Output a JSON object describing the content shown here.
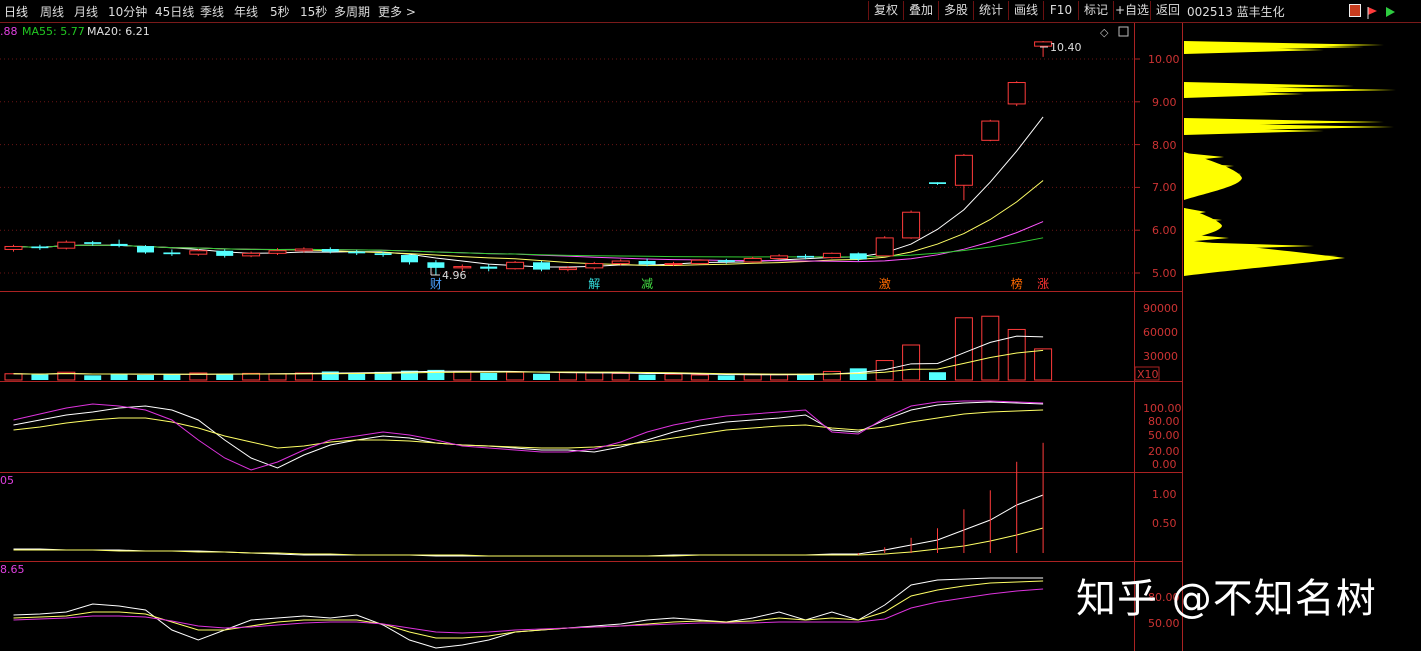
{
  "toolbar": {
    "periods": [
      "日线",
      "周线",
      "月线",
      "10分钟",
      "45日线",
      "季线",
      "年线",
      "5秒",
      "15秒",
      "多周期",
      "更多 >"
    ],
    "buttons": [
      "复权",
      "叠加",
      "多股",
      "统计",
      "画线",
      "F10",
      "标记",
      "+自选",
      "返回"
    ],
    "stock": "002513 蓝丰生化"
  },
  "main_panel": {
    "ma_labels": [
      {
        "text": ".88",
        "color": "#e040e0"
      },
      {
        "text": "MA55: 5.77",
        "color": "#22c822"
      },
      {
        "text": "MA20: 6.21",
        "color": "#e0e0e0"
      }
    ],
    "max_label": "10.40",
    "min_label": "4.96",
    "price_axis": [
      "10.00",
      "9.00",
      "8.00",
      "7.00",
      "6.00",
      "5.00"
    ],
    "event_markers": [
      {
        "text": "财",
        "color": "#4aa0ff",
        "bar": 16
      },
      {
        "text": "解",
        "color": "#33dddd",
        "bar": 22
      },
      {
        "text": "减",
        "color": "#44dd44",
        "bar": 24
      },
      {
        "text": "激",
        "color": "#ff6a00",
        "bar": 33
      },
      {
        "text": "榜",
        "color": "#ff6a00",
        "bar": 38
      },
      {
        "text": "涨",
        "color": "#ff3333",
        "bar": 39
      }
    ]
  },
  "volume_panel": {
    "axis": [
      "90000",
      "60000",
      "30000"
    ],
    "unit": "X10"
  },
  "panel3": {
    "axis": [
      "100.00",
      "80.00",
      "50.00",
      "20.00",
      "0.00"
    ]
  },
  "panel4": {
    "label": "05",
    "axis": [
      "1.00",
      "0.50"
    ]
  },
  "panel5": {
    "label": "8.65",
    "axis": [
      "80.00",
      "50.00"
    ]
  },
  "watermark": "知乎 @不知名树",
  "chart_data": {
    "type": "candlestick",
    "bars": [
      {
        "o": 5.55,
        "c": 5.62,
        "h": 5.66,
        "l": 5.5
      },
      {
        "o": 5.62,
        "c": 5.58,
        "h": 5.66,
        "l": 5.54
      },
      {
        "o": 5.58,
        "c": 5.72,
        "h": 5.76,
        "l": 5.55
      },
      {
        "o": 5.72,
        "c": 5.68,
        "h": 5.75,
        "l": 5.64
      },
      {
        "o": 5.68,
        "c": 5.63,
        "h": 5.78,
        "l": 5.6
      },
      {
        "o": 5.63,
        "c": 5.48,
        "h": 5.65,
        "l": 5.45
      },
      {
        "o": 5.48,
        "c": 5.44,
        "h": 5.55,
        "l": 5.4
      },
      {
        "o": 5.44,
        "c": 5.52,
        "h": 5.56,
        "l": 5.4
      },
      {
        "o": 5.52,
        "c": 5.4,
        "h": 5.55,
        "l": 5.36
      },
      {
        "o": 5.4,
        "c": 5.46,
        "h": 5.5,
        "l": 5.37
      },
      {
        "o": 5.46,
        "c": 5.52,
        "h": 5.58,
        "l": 5.42
      },
      {
        "o": 5.52,
        "c": 5.56,
        "h": 5.6,
        "l": 5.48
      },
      {
        "o": 5.56,
        "c": 5.5,
        "h": 5.6,
        "l": 5.46
      },
      {
        "o": 5.5,
        "c": 5.46,
        "h": 5.54,
        "l": 5.42
      },
      {
        "o": 5.46,
        "c": 5.42,
        "h": 5.5,
        "l": 5.38
      },
      {
        "o": 5.42,
        "c": 5.25,
        "h": 5.44,
        "l": 5.2
      },
      {
        "o": 5.25,
        "c": 5.12,
        "h": 5.3,
        "l": 4.96
      },
      {
        "o": 5.12,
        "c": 5.15,
        "h": 5.2,
        "l": 5.05
      },
      {
        "o": 5.15,
        "c": 5.1,
        "h": 5.2,
        "l": 5.04
      },
      {
        "o": 5.1,
        "c": 5.25,
        "h": 5.28,
        "l": 5.08
      },
      {
        "o": 5.25,
        "c": 5.08,
        "h": 5.28,
        "l": 5.04
      },
      {
        "o": 5.08,
        "c": 5.12,
        "h": 5.16,
        "l": 5.04
      },
      {
        "o": 5.12,
        "c": 5.22,
        "h": 5.26,
        "l": 5.08
      },
      {
        "o": 5.22,
        "c": 5.28,
        "h": 5.32,
        "l": 5.18
      },
      {
        "o": 5.28,
        "c": 5.2,
        "h": 5.34,
        "l": 5.16
      },
      {
        "o": 5.2,
        "c": 5.22,
        "h": 5.26,
        "l": 5.16
      },
      {
        "o": 5.22,
        "c": 5.3,
        "h": 5.32,
        "l": 5.2
      },
      {
        "o": 5.3,
        "c": 5.26,
        "h": 5.33,
        "l": 5.22
      },
      {
        "o": 5.26,
        "c": 5.34,
        "h": 5.38,
        "l": 5.24
      },
      {
        "o": 5.34,
        "c": 5.4,
        "h": 5.44,
        "l": 5.3
      },
      {
        "o": 5.4,
        "c": 5.36,
        "h": 5.44,
        "l": 5.32
      },
      {
        "o": 5.36,
        "c": 5.46,
        "h": 5.48,
        "l": 5.34
      },
      {
        "o": 5.46,
        "c": 5.32,
        "h": 5.48,
        "l": 5.28
      },
      {
        "o": 5.4,
        "c": 5.82,
        "h": 5.86,
        "l": 5.38
      },
      {
        "o": 5.82,
        "c": 6.42,
        "h": 6.46,
        "l": 5.8
      },
      {
        "o": 7.12,
        "c": 7.08,
        "h": 7.12,
        "l": 7.06
      },
      {
        "o": 7.05,
        "c": 7.75,
        "h": 7.78,
        "l": 6.7
      },
      {
        "o": 8.1,
        "c": 8.55,
        "h": 8.58,
        "l": 8.08
      },
      {
        "o": 8.95,
        "c": 9.45,
        "h": 9.48,
        "l": 8.9
      },
      {
        "o": 10.3,
        "c": 10.4,
        "h": 10.42,
        "l": 10.05
      }
    ],
    "volume_x10": [
      8000,
      7000,
      10000,
      6000,
      7500,
      6500,
      7000,
      9000,
      7500,
      8500,
      8000,
      9000,
      11000,
      9500,
      10500,
      12000,
      13000,
      11000,
      9000,
      10000,
      8000,
      9500,
      9000,
      8500,
      7000,
      7500,
      6500,
      6000,
      7000,
      6800,
      8000,
      11000,
      15000,
      25000,
      45000,
      10000,
      80000,
      82000,
      65000,
      40000
    ]
  }
}
